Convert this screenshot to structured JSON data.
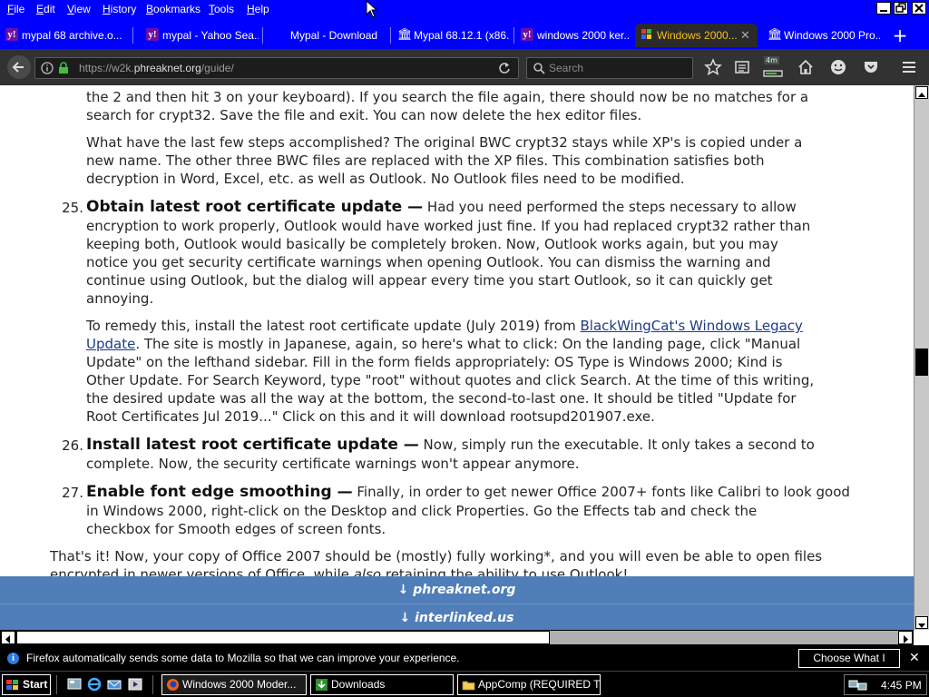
{
  "menu": {
    "items": [
      {
        "label": "File",
        "key": "F",
        "rest": "ile"
      },
      {
        "label": "Edit",
        "key": "E",
        "rest": "dit"
      },
      {
        "label": "View",
        "key": "V",
        "rest": "iew"
      },
      {
        "label": "History",
        "key": "H",
        "rest": "istory"
      },
      {
        "label": "Bookmarks",
        "key": "B",
        "rest": "ookmarks"
      },
      {
        "label": "Tools",
        "key": "T",
        "rest": "ools"
      },
      {
        "label": "Help",
        "key": "H",
        "rest": "elp"
      }
    ]
  },
  "tabs": [
    {
      "label": "mypal 68 archive.o...",
      "favicon": "yahoo-icon"
    },
    {
      "label": "mypal - Yahoo Sea...",
      "favicon": "yahoo-icon"
    },
    {
      "label": "Mypal - Download",
      "favicon": "none"
    },
    {
      "label": "Mypal 68.12.1 (x86...",
      "favicon": "bank-icon"
    },
    {
      "label": "windows 2000 ker...",
      "favicon": "yahoo-icon"
    },
    {
      "label": "Windows 2000...",
      "favicon": "windows-flag-icon",
      "active": true
    },
    {
      "label": "Windows 2000 Pro...",
      "favicon": "bank-icon"
    }
  ],
  "new_tab": "+",
  "navbar": {
    "url_prefix": "https://w2k.",
    "url_domain": "phreaknet.org",
    "url_suffix": "/guide/",
    "search_placeholder": "Search",
    "download_badge": "4m"
  },
  "article": {
    "lines_top": [
      "the 2 and then hit 3 on your keyboard). If you search the file again, there should now be no matches for a",
      "search for crypt32. Save the file and exit. You can now delete the hex editor files."
    ],
    "para_recap": [
      "What have the last few steps accomplished? The original BWC crypt32 stays while XP's is copied under a",
      "new name. The other three BWC files are replaced with the XP files. This combination satisfies both",
      "decryption in Word, Excel, etc. as well as Outlook. No Outlook files need to be modified."
    ],
    "step25": {
      "number": "25.",
      "heading": "Obtain latest root certificate update —",
      "first_line_rest": " Had you need performed the steps necessary to allow",
      "lines": [
        "encryption to work properly, Outlook would have worked just fine. If you had replaced crypt32 rather than",
        "keeping both, Outlook would basically be completely broken. Now, Outlook works again, but you may",
        "notice you get security certificate warnings when opening Outlook. You can dismiss the warning and",
        "continue using Outlook, but the dialog will appear every time you start Outlook, so it can quickly get",
        "annoying."
      ],
      "remedy_line1_pre": "To remedy this, install the latest root certificate update (July 2019) from ",
      "remedy_link_part1": "BlackWingCat's Windows Legacy",
      "remedy_link_part2": "Update",
      "remedy_line2_post": ". The site is mostly in Japanese, again, so here's what to click: On the landing page, click \"Manual",
      "remedy_lines": [
        "Update\" on the lefthand sidebar. Fill in the form fields appropriately: OS Type is Windows 2000; Kind is",
        "Other Update. For Search Keyword, type \"root\" without quotes and click Search. At the time of this writing,",
        "the desired update was all the way at the bottom, the second-to-last one. It should be titled \"Update for",
        "Root Certificates Jul 2019...\" Click on this and it will download rootsupd201907.exe."
      ]
    },
    "step26": {
      "number": "26.",
      "heading": "Install latest root certificate update —",
      "first_line_rest": " Now, simply run the executable. It only takes a second to",
      "lines": [
        "complete. Now, the security certificate warnings won't appear anymore."
      ]
    },
    "step27": {
      "number": "27.",
      "heading": "Enable font edge smoothing —",
      "first_line_rest": " Finally, in order to get newer Office 2007+ fonts like Calibri to look good",
      "lines": [
        "in Windows 2000, right-click on the Desktop and click Properties. Go the Effects tab and check the",
        "checkbox for Smooth edges of screen fonts."
      ]
    },
    "closing_line1": "That's it! Now, your copy of Office 2007 should be (mostly) fully working*, and you will even be able to open files",
    "closing_line2_pre": "encrypted in newer versions of Office, while ",
    "closing_line2_em": "also",
    "closing_line2_post": " retaining the ability to use Outlook!"
  },
  "footer": {
    "link1": "↓ phreaknet.org",
    "link2": "↓ interlinked.us"
  },
  "notification": {
    "text": "Firefox automatically sends some data to Mozilla so that we can improve your experience.",
    "button": "Choose What I Share",
    "close": "✕"
  },
  "taskbar": {
    "start": "Start",
    "tasks": [
      {
        "label": "Windows 2000 Moder...",
        "icon": "firefox-icon",
        "active": true
      },
      {
        "label": "Downloads",
        "icon": "download-icon"
      },
      {
        "label": "AppComp (REQUIRED T...",
        "icon": "folder-icon"
      }
    ],
    "clock": "4:45 PM"
  },
  "colors": {
    "menubar": "#0000ff",
    "active_tab_text": "#f6c21b",
    "link": "#1d3c85",
    "footer_band": "#4f7eb8"
  }
}
